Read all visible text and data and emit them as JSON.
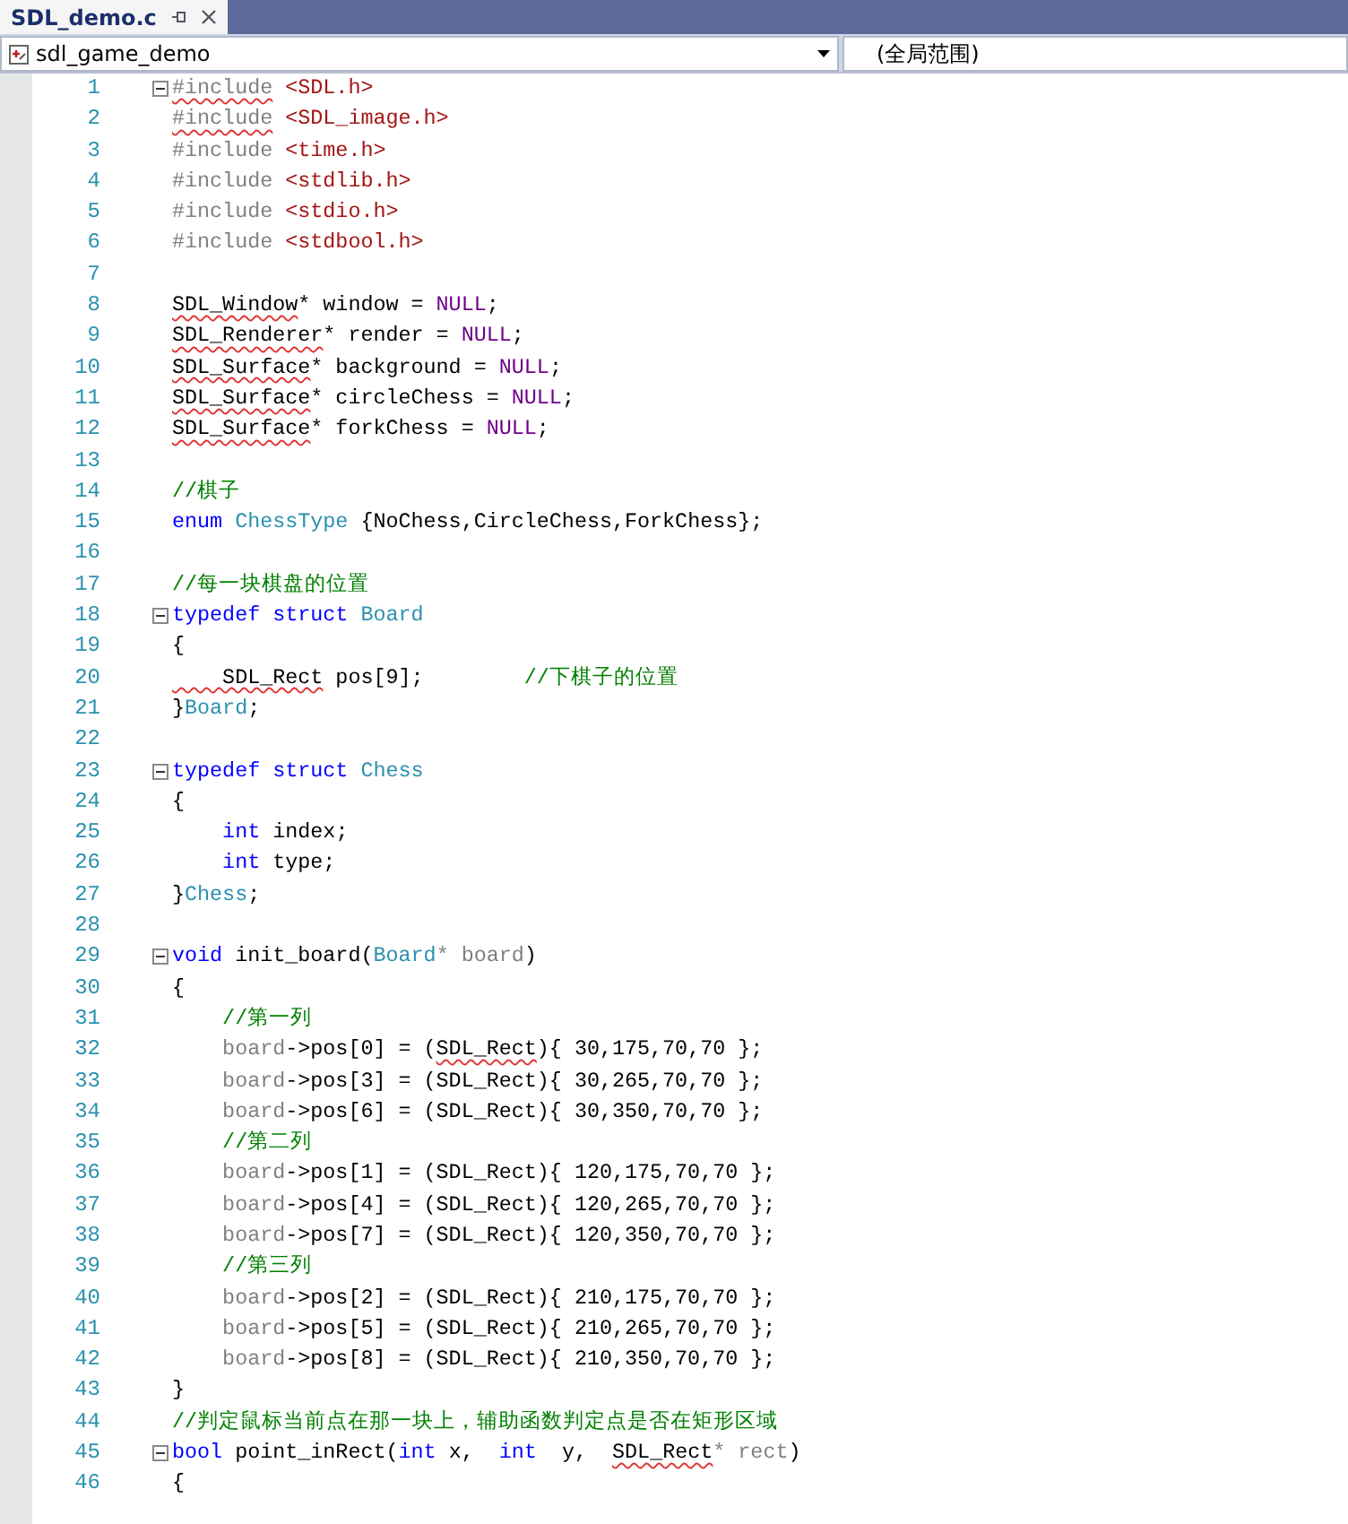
{
  "tabs": [
    {
      "label": "SDL_demo.c",
      "selected": true
    }
  ],
  "navigation": {
    "project": "sdl_game_demo",
    "scope": "(全局范围)"
  },
  "lines": [
    {
      "number": "1",
      "fold": true,
      "tokens": [
        {
          "t": "#include",
          "kind": "directive",
          "err": true
        },
        {
          "t": " <SDL.h>",
          "kind": "string"
        }
      ]
    },
    {
      "number": "2",
      "tokens": [
        {
          "t": "#include",
          "kind": "directive",
          "err": true
        },
        {
          "t": " <SDL_image.h>",
          "kind": "string"
        }
      ]
    },
    {
      "number": "3",
      "tokens": [
        {
          "t": "#include",
          "kind": "directive"
        },
        {
          "t": " <time.h>",
          "kind": "string"
        }
      ]
    },
    {
      "number": "4",
      "tokens": [
        {
          "t": "#include",
          "kind": "directive"
        },
        {
          "t": " <stdlib.h>",
          "kind": "string"
        }
      ]
    },
    {
      "number": "5",
      "tokens": [
        {
          "t": "#include",
          "kind": "directive"
        },
        {
          "t": " <stdio.h>",
          "kind": "string"
        }
      ]
    },
    {
      "number": "6",
      "tokens": [
        {
          "t": "#include",
          "kind": "directive"
        },
        {
          "t": " <stdbool.h>",
          "kind": "string"
        }
      ]
    },
    {
      "number": "7"
    },
    {
      "number": "8",
      "tokens": [
        {
          "t": "SDL_Window",
          "kind": "plain",
          "err": true
        },
        {
          "t": "* window = ",
          "kind": "plain"
        },
        {
          "t": "NULL",
          "kind": "macro"
        },
        {
          "t": ";",
          "kind": "plain"
        }
      ]
    },
    {
      "number": "9",
      "tokens": [
        {
          "t": "SDL_Renderer",
          "kind": "plain",
          "err": true
        },
        {
          "t": "* render = ",
          "kind": "plain"
        },
        {
          "t": "NULL",
          "kind": "macro"
        },
        {
          "t": ";",
          "kind": "plain"
        }
      ]
    },
    {
      "number": "10",
      "tokens": [
        {
          "t": "SDL_Surface",
          "kind": "plain",
          "err": true
        },
        {
          "t": "* background = ",
          "kind": "plain"
        },
        {
          "t": "NULL",
          "kind": "macro"
        },
        {
          "t": ";",
          "kind": "plain"
        }
      ]
    },
    {
      "number": "11",
      "tokens": [
        {
          "t": "SDL_Surface",
          "kind": "plain",
          "err": true
        },
        {
          "t": "* circleChess = ",
          "kind": "plain"
        },
        {
          "t": "NULL",
          "kind": "macro"
        },
        {
          "t": ";",
          "kind": "plain"
        }
      ]
    },
    {
      "number": "12",
      "tokens": [
        {
          "t": "SDL_Surface",
          "kind": "plain",
          "err": true
        },
        {
          "t": "* forkChess = ",
          "kind": "plain"
        },
        {
          "t": "NULL",
          "kind": "macro"
        },
        {
          "t": ";",
          "kind": "plain"
        }
      ]
    },
    {
      "number": "13"
    },
    {
      "number": "14",
      "tokens": [
        {
          "t": "//棋子",
          "kind": "comment"
        }
      ]
    },
    {
      "number": "15",
      "tokens": [
        {
          "t": "enum ",
          "kind": "keyword"
        },
        {
          "t": "ChessType",
          "kind": "type"
        },
        {
          "t": " {NoChess,CircleChess,ForkChess};",
          "kind": "plain"
        }
      ]
    },
    {
      "number": "16"
    },
    {
      "number": "17",
      "tokens": [
        {
          "t": "//每一块棋盘的位置",
          "kind": "comment"
        }
      ]
    },
    {
      "number": "18",
      "fold": true,
      "tokens": [
        {
          "t": "typedef struct ",
          "kind": "keyword"
        },
        {
          "t": "Board",
          "kind": "type"
        }
      ]
    },
    {
      "number": "19",
      "tokens": [
        {
          "t": "{",
          "kind": "plain"
        }
      ]
    },
    {
      "number": "20",
      "tokens": [
        {
          "t": "    SDL_Rect",
          "kind": "plain",
          "err": true
        },
        {
          "t": " pos[9];        ",
          "kind": "plain"
        },
        {
          "t": "//下棋子的位置",
          "kind": "comment"
        }
      ]
    },
    {
      "number": "21",
      "tokens": [
        {
          "t": "}",
          "kind": "plain"
        },
        {
          "t": "Board",
          "kind": "type"
        },
        {
          "t": ";",
          "kind": "plain"
        }
      ]
    },
    {
      "number": "22"
    },
    {
      "number": "23",
      "fold": true,
      "tokens": [
        {
          "t": "typedef struct ",
          "kind": "keyword"
        },
        {
          "t": "Chess",
          "kind": "type"
        }
      ]
    },
    {
      "number": "24",
      "tokens": [
        {
          "t": "{",
          "kind": "plain"
        }
      ]
    },
    {
      "number": "25",
      "tokens": [
        {
          "t": "    int",
          "kind": "keyword"
        },
        {
          "t": " index;",
          "kind": "plain"
        }
      ]
    },
    {
      "number": "26",
      "tokens": [
        {
          "t": "    int",
          "kind": "keyword"
        },
        {
          "t": " type;",
          "kind": "plain"
        }
      ]
    },
    {
      "number": "27",
      "tokens": [
        {
          "t": "}",
          "kind": "plain"
        },
        {
          "t": "Chess",
          "kind": "type"
        },
        {
          "t": ";",
          "kind": "plain"
        }
      ]
    },
    {
      "number": "28"
    },
    {
      "number": "29",
      "fold": true,
      "tokens": [
        {
          "t": "void",
          "kind": "keyword"
        },
        {
          "t": " init_board(",
          "kind": "plain"
        },
        {
          "t": "Board",
          "kind": "type"
        },
        {
          "t": "* board",
          "kind": "param"
        },
        {
          "t": ")",
          "kind": "plain"
        }
      ]
    },
    {
      "number": "30",
      "tokens": [
        {
          "t": "{",
          "kind": "plain"
        }
      ]
    },
    {
      "number": "31",
      "tokens": [
        {
          "t": "    //第一列",
          "kind": "comment"
        }
      ]
    },
    {
      "number": "32",
      "tokens": [
        {
          "t": "    board",
          "kind": "param"
        },
        {
          "t": "->pos[0] = (",
          "kind": "plain"
        },
        {
          "t": "SDL_Rect",
          "kind": "plain",
          "err": true
        },
        {
          "t": "){ 30,175,70,70 };",
          "kind": "plain"
        }
      ]
    },
    {
      "number": "33",
      "tokens": [
        {
          "t": "    board",
          "kind": "param"
        },
        {
          "t": "->pos[3] = (SDL_Rect){ 30,265,70,70 };",
          "kind": "plain"
        }
      ]
    },
    {
      "number": "34",
      "tokens": [
        {
          "t": "    board",
          "kind": "param"
        },
        {
          "t": "->pos[6] = (SDL_Rect){ 30,350,70,70 };",
          "kind": "plain"
        }
      ]
    },
    {
      "number": "35",
      "tokens": [
        {
          "t": "    //第二列",
          "kind": "comment"
        }
      ]
    },
    {
      "number": "36",
      "tokens": [
        {
          "t": "    board",
          "kind": "param"
        },
        {
          "t": "->pos[1] = (SDL_Rect){ 120,175,70,70 };",
          "kind": "plain"
        }
      ]
    },
    {
      "number": "37",
      "tokens": [
        {
          "t": "    board",
          "kind": "param"
        },
        {
          "t": "->pos[4] = (SDL_Rect){ 120,265,70,70 };",
          "kind": "plain"
        }
      ]
    },
    {
      "number": "38",
      "tokens": [
        {
          "t": "    board",
          "kind": "param"
        },
        {
          "t": "->pos[7] = (SDL_Rect){ 120,350,70,70 };",
          "kind": "plain"
        }
      ]
    },
    {
      "number": "39",
      "tokens": [
        {
          "t": "    //第三列",
          "kind": "comment"
        }
      ]
    },
    {
      "number": "40",
      "tokens": [
        {
          "t": "    board",
          "kind": "param"
        },
        {
          "t": "->pos[2] = (SDL_Rect){ 210,175,70,70 };",
          "kind": "plain"
        }
      ]
    },
    {
      "number": "41",
      "tokens": [
        {
          "t": "    board",
          "kind": "param"
        },
        {
          "t": "->pos[5] = (SDL_Rect){ 210,265,70,70 };",
          "kind": "plain"
        }
      ]
    },
    {
      "number": "42",
      "tokens": [
        {
          "t": "    board",
          "kind": "param"
        },
        {
          "t": "->pos[8] = (SDL_Rect){ 210,350,70,70 };",
          "kind": "plain"
        }
      ]
    },
    {
      "number": "43",
      "tokens": [
        {
          "t": "}",
          "kind": "plain"
        }
      ]
    },
    {
      "number": "44",
      "tokens": [
        {
          "t": "//判定鼠标当前点在那一块上，辅助函数判定点是否在矩形区域",
          "kind": "comment"
        }
      ]
    },
    {
      "number": "45",
      "fold": true,
      "tokens": [
        {
          "t": "bool",
          "kind": "keyword"
        },
        {
          "t": " point_inRect(",
          "kind": "plain"
        },
        {
          "t": "int",
          "kind": "keyword"
        },
        {
          "t": " x,  ",
          "kind": "plain"
        },
        {
          "t": "int",
          "kind": "keyword"
        },
        {
          "t": "  y,  ",
          "kind": "plain"
        },
        {
          "t": "SDL_Rect",
          "kind": "plain",
          "err": true
        },
        {
          "t": "* rect",
          "kind": "param"
        },
        {
          "t": ")",
          "kind": "plain"
        }
      ]
    },
    {
      "number": "46",
      "tokens": [
        {
          "t": "{",
          "kind": "plain"
        }
      ]
    }
  ]
}
